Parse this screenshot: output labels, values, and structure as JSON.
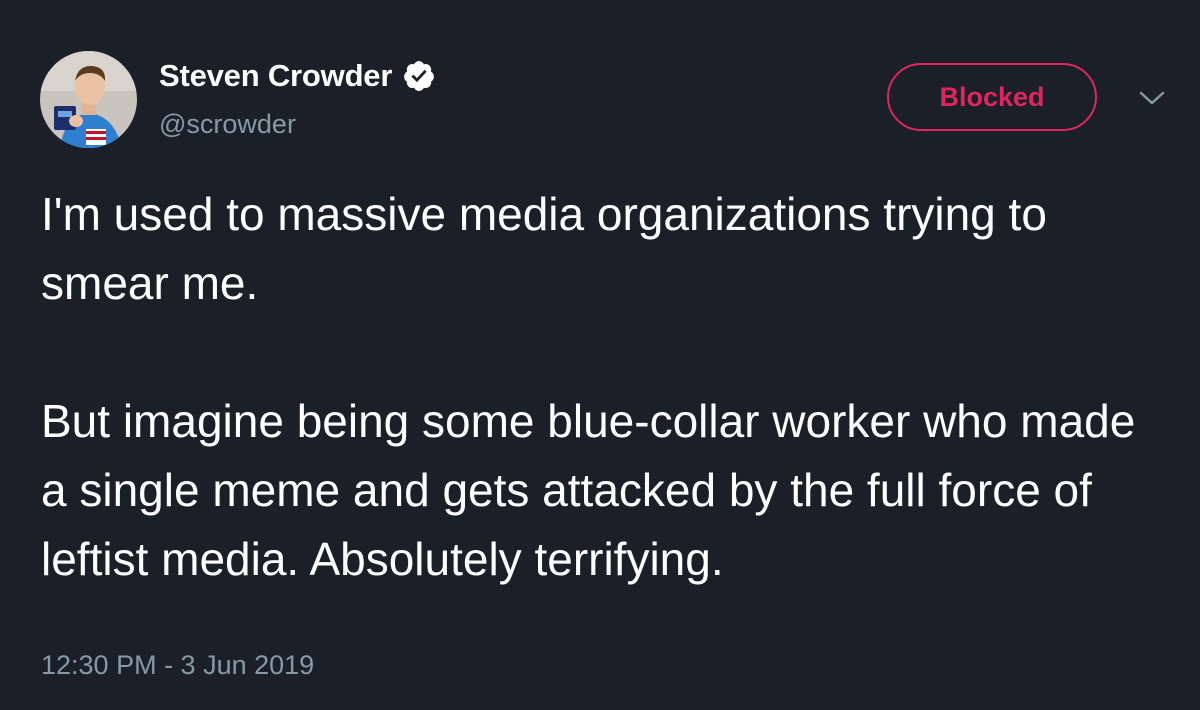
{
  "author": {
    "display_name": "Steven Crowder",
    "handle": "@scrowder",
    "verified": true,
    "avatar_icon": "user-avatar"
  },
  "actions": {
    "follow_state_label": "Blocked",
    "menu_icon": "chevron-down-icon"
  },
  "tweet": {
    "paragraphs": [
      "I'm used to massive media organizations trying to smear me.",
      "But imagine being some blue-collar worker who made a single meme and gets attacked by the full force of leftist media. Absolutely terrifying."
    ],
    "timestamp": "12:30 PM - 3 Jun 2019"
  },
  "colors": {
    "background": "#1b1f27",
    "text_primary": "#ffffff",
    "text_secondary": "#8899a6",
    "blocked_accent": "#e0245e"
  }
}
